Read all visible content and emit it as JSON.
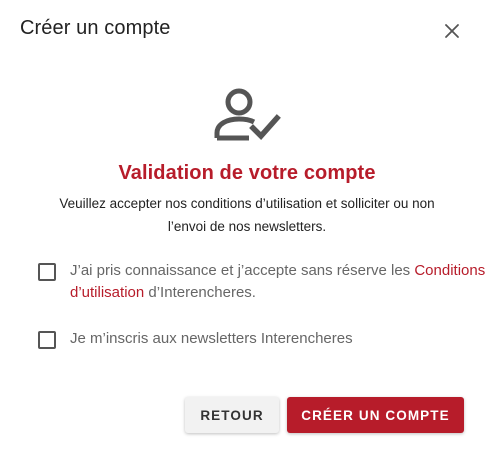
{
  "dialog": {
    "title": "Créer un compte",
    "close_icon": "close-icon"
  },
  "hero": {
    "icon": "user-check-icon",
    "heading": "Validation de votre compte",
    "subtext": "Veuillez accepter nos conditions d’utilisation et solliciter ou non l’envoi de nos newsletters."
  },
  "checks": {
    "terms": {
      "checked": false,
      "label_before": "J’ai pris connaissance et j’accepte sans réserve les ",
      "link_text": "Conditions d’utilisation",
      "label_after": " d’Interencheres."
    },
    "newsletter": {
      "checked": false,
      "label": "Je m’inscris aux newsletters Interencheres"
    }
  },
  "buttons": {
    "back_label": "RETOUR",
    "create_label": "CRÉER UN COMPTE"
  },
  "colors": {
    "accent": "#b71c2a",
    "icon_gray": "#555555"
  }
}
